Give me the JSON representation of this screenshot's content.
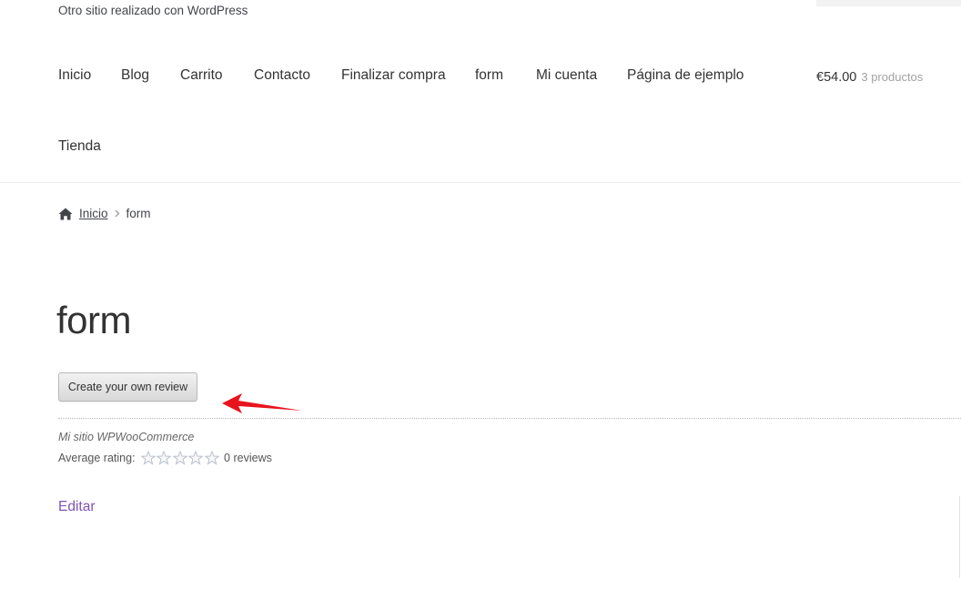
{
  "site": {
    "tagline": "Otro sitio realizado con WordPress"
  },
  "nav": {
    "items": [
      {
        "label": "Inicio"
      },
      {
        "label": "Blog"
      },
      {
        "label": "Carrito"
      },
      {
        "label": "Contacto"
      },
      {
        "label": "Finalizar compra"
      },
      {
        "label": "form"
      },
      {
        "label": "Mi cuenta"
      },
      {
        "label": "Página de ejemplo"
      },
      {
        "label": "Tienda"
      }
    ]
  },
  "cart": {
    "amount": "€54.00",
    "count": "3 productos"
  },
  "breadcrumb": {
    "icon": "home-icon",
    "home_label": "Inicio",
    "separator_icon": "chevron-right-icon",
    "current": "form"
  },
  "page": {
    "title": "form",
    "review_button_label": "Create your own review"
  },
  "review_summary": {
    "site_name": "Mi sitio WPWooCommerce",
    "average_label": "Average rating:",
    "rating": 0,
    "max_rating": 5,
    "reviews_count": "0 reviews"
  },
  "edit": {
    "label": "Editar"
  },
  "colors": {
    "link_purple": "#7f54b3",
    "arrow_red": "#e8141c",
    "text_dark": "#333333",
    "muted": "#a2a2a2"
  }
}
